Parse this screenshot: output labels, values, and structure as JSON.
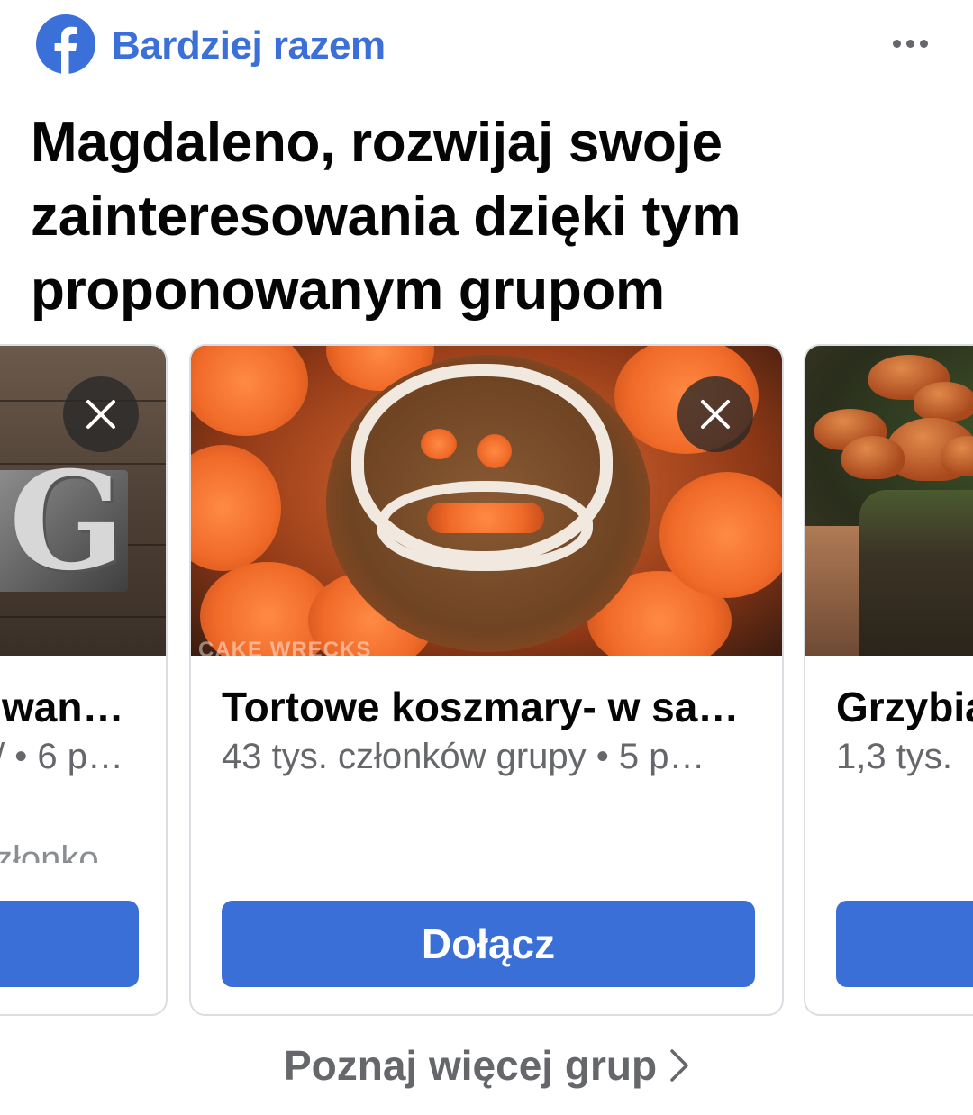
{
  "header": {
    "brand": "Bardziej razem",
    "logo_icon": "facebook-logo-icon",
    "more_icon": "more-options-icon",
    "brand_color": "#3a70d8"
  },
  "headline": "Magdaleno, rozwijaj swoje zainteresowania dzięki tym proponowanym grupom",
  "cards": [
    {
      "title": "wan…",
      "meta": "/ • 6 p…",
      "extra": "złonko",
      "image_icon": "group-photo-letters",
      "close_icon": "close-icon",
      "button": ""
    },
    {
      "title": "Tortowe koszmary- w sa…",
      "meta": "43 tys. członków grupy • 5 p…",
      "image_caption": "CAKE WRECKS",
      "image_icon": "group-photo-cake",
      "close_icon": "close-icon",
      "button": "Dołącz"
    },
    {
      "title": "Grzybia",
      "meta": "1,3 tys.",
      "image_icon": "group-photo-mushrooms",
      "button": ""
    }
  ],
  "footer": {
    "more_groups": "Poznaj więcej grup",
    "chevron_icon": "chevron-right-icon"
  },
  "colors": {
    "accent": "#3a6fd8",
    "secondary_text": "#65676b"
  }
}
